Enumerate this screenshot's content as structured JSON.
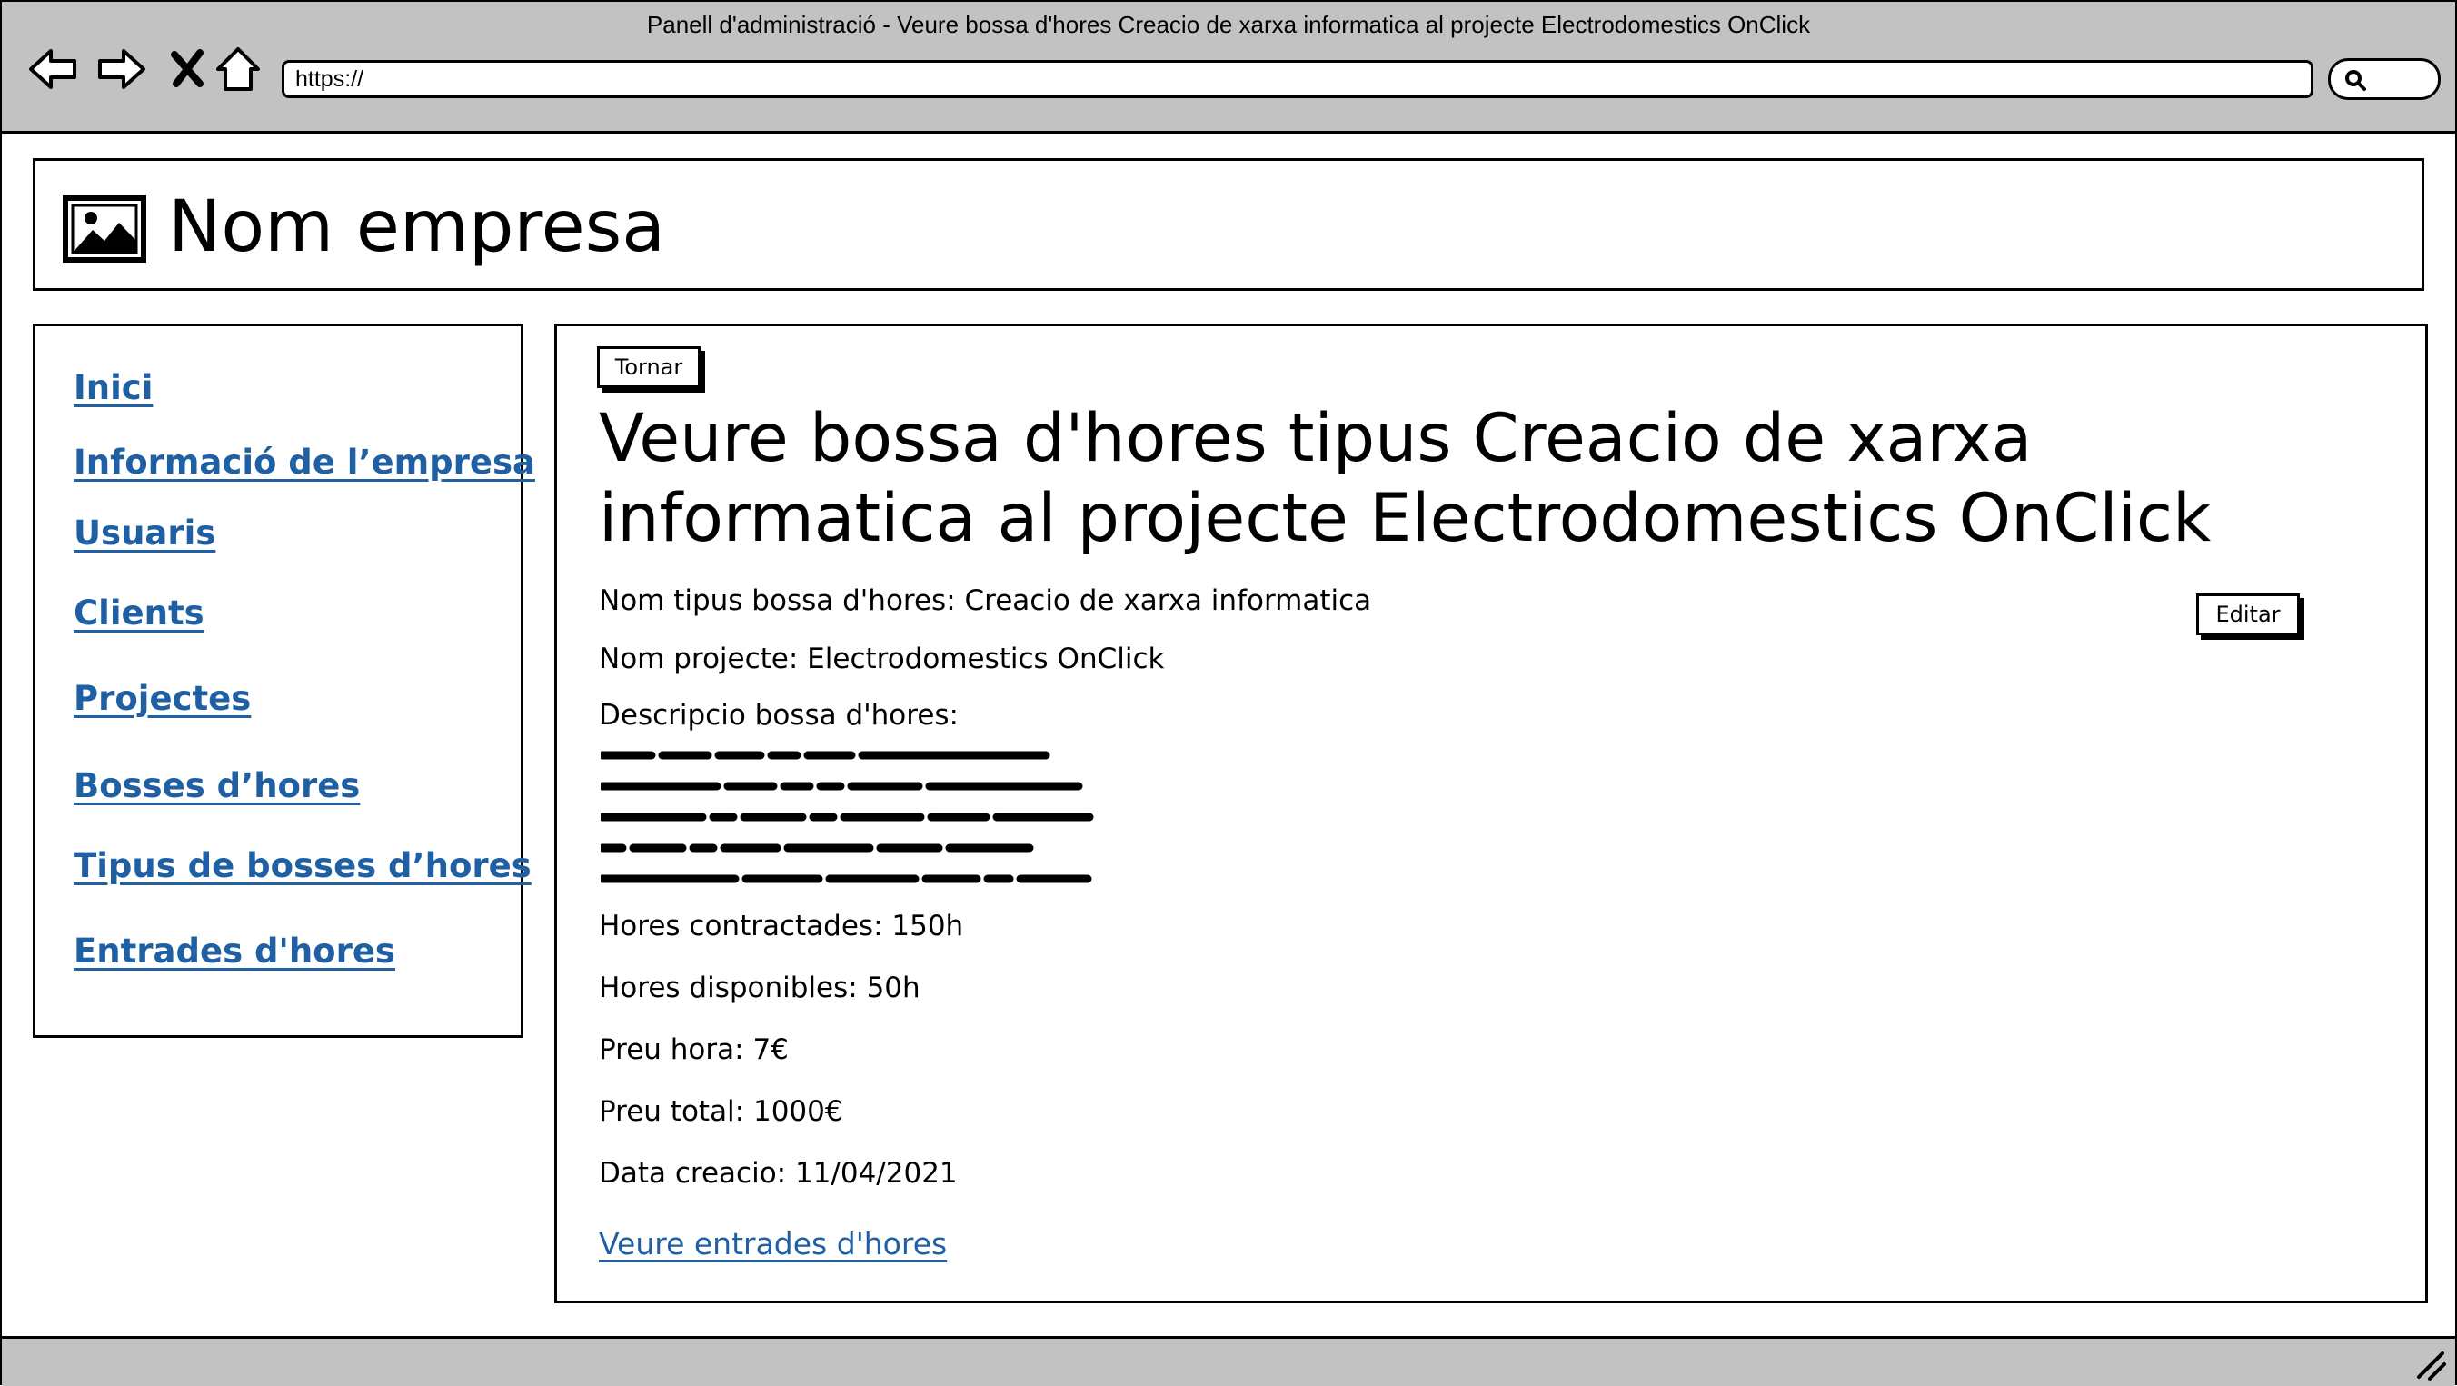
{
  "window": {
    "title": "Panell d'administració - Veure bossa d'hores Creacio de xarxa informatica al projecte Electrodomestics OnClick",
    "url": "https://"
  },
  "icons": {
    "back": "back-arrow-icon",
    "forward": "forward-arrow-icon",
    "close": "close-icon",
    "home": "home-icon",
    "search": "search-icon",
    "logo": "image-placeholder-icon",
    "resize": "resize-grip-icon"
  },
  "header": {
    "company_name": "Nom empresa"
  },
  "sidebar": {
    "items": [
      {
        "label": "Inici"
      },
      {
        "label": "Informació de l’empresa"
      },
      {
        "label": "Usuaris"
      },
      {
        "label": "Clients"
      },
      {
        "label": "Projectes"
      },
      {
        "label": "Bosses d’hores"
      },
      {
        "label": "Tipus de bosses d’hores"
      },
      {
        "label": "Entrades d'hores"
      }
    ]
  },
  "main": {
    "back_button": "Tornar",
    "heading": "Veure bossa d'hores tipus Creacio de xarxa informatica al projecte Electrodomestics OnClick",
    "edit_button": "Editar",
    "fields": {
      "tipus": "Nom tipus bossa d'hores: Creacio de xarxa informatica",
      "projecte": "Nom projecte: Electrodomestics OnClick",
      "descripcio": "Descripcio bossa d'hores:",
      "hores_contractades": "Hores contractades: 150h",
      "hores_disponibles": "Hores disponibles: 50h",
      "preu_hora": "Preu hora: 7€",
      "preu_total": "Preu total: 1000€",
      "data_creacio": "Data creacio: 11/04/2021"
    },
    "link": "Veure entrades d'hores"
  },
  "colors": {
    "chrome": "#c2c2c2",
    "link": "#1f5fa3",
    "border": "#000000"
  }
}
